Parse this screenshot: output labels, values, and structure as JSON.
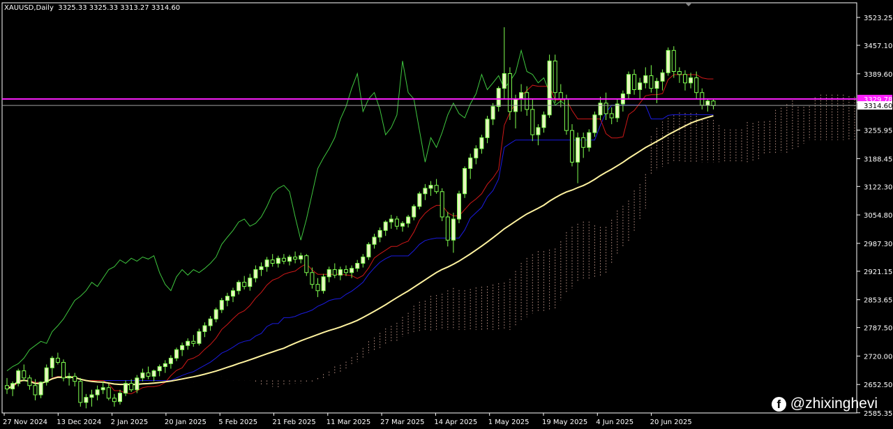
{
  "header": {
    "symbol": "XAUUSD,Daily",
    "ohlc": "3325.33 3325.33 3313.27 3314.60"
  },
  "watermark": {
    "handle": "@zhixinghevi",
    "icon": "facebook-icon"
  },
  "colors": {
    "background": "#000000",
    "candle_up": "#e8f5c0",
    "candle_down": "#000000",
    "candle_wick": "#7fff4f",
    "chikou": "#3fc83f",
    "tenkan": "#d01818",
    "kijun": "#1b1be0",
    "ma": "#fff3a0",
    "horizontal_line": "#ff20ff",
    "price_line": "#a0a0a0",
    "cloud": "#e0b0a0"
  },
  "chart_data": {
    "type": "candlestick",
    "title": "",
    "symbol": "XAUUSD",
    "timeframe": "Daily",
    "ylim": [
      2585,
      3558
    ],
    "y_ticks": [
      3523.25,
      3457.1,
      3389.6,
      3322.1,
      3255.95,
      3188.45,
      3122.3,
      3054.8,
      2987.3,
      2921.15,
      2853.65,
      2787.5,
      2720.0,
      2652.5,
      2585.35
    ],
    "y_tick_labels": [
      "3523.25",
      "3457.10",
      "3389.60",
      "",
      "3255.95",
      "3188.45",
      "3122.30",
      "3054.80",
      "2987.30",
      "2921.15",
      "2853.65",
      "2787.50",
      "2720.00",
      "2652.50",
      "2585.35"
    ],
    "x_tick_labels": [
      "27 Nov 2024",
      "13 Dec 2024",
      "2 Jan 2025",
      "20 Jan 2025",
      "5 Feb 2025",
      "21 Feb 2025",
      "11 Mar 2025",
      "27 Mar 2025",
      "14 Apr 2025",
      "1 May 2025",
      "19 May 2025",
      "4 Jun 2025",
      "20 Jun 2025"
    ],
    "horizontal_line": {
      "value": 3329.78,
      "label": "3329.78"
    },
    "current_price": {
      "value": 3314.6,
      "label": "3314.60"
    },
    "ohlc": [
      [
        2650,
        2668,
        2630,
        2642
      ],
      [
        2642,
        2660,
        2625,
        2655
      ],
      [
        2655,
        2690,
        2648,
        2685
      ],
      [
        2685,
        2700,
        2660,
        2668
      ],
      [
        2668,
        2675,
        2640,
        2650
      ],
      [
        2650,
        2665,
        2615,
        2628
      ],
      [
        2628,
        2660,
        2620,
        2658
      ],
      [
        2658,
        2700,
        2650,
        2692
      ],
      [
        2692,
        2720,
        2670,
        2715
      ],
      [
        2715,
        2728,
        2700,
        2705
      ],
      [
        2705,
        2712,
        2660,
        2668
      ],
      [
        2668,
        2680,
        2650,
        2672
      ],
      [
        2672,
        2680,
        2648,
        2660
      ],
      [
        2660,
        2668,
        2600,
        2610
      ],
      [
        2610,
        2630,
        2596,
        2622
      ],
      [
        2622,
        2640,
        2600,
        2628
      ],
      [
        2628,
        2650,
        2615,
        2640
      ],
      [
        2640,
        2660,
        2630,
        2645
      ],
      [
        2645,
        2655,
        2615,
        2620
      ],
      [
        2620,
        2630,
        2600,
        2612
      ],
      [
        2612,
        2640,
        2605,
        2632
      ],
      [
        2632,
        2662,
        2625,
        2655
      ],
      [
        2655,
        2665,
        2635,
        2640
      ],
      [
        2640,
        2675,
        2632,
        2668
      ],
      [
        2668,
        2690,
        2660,
        2680
      ],
      [
        2680,
        2695,
        2665,
        2672
      ],
      [
        2672,
        2688,
        2660,
        2685
      ],
      [
        2685,
        2700,
        2672,
        2695
      ],
      [
        2695,
        2710,
        2680,
        2702
      ],
      [
        2702,
        2722,
        2690,
        2715
      ],
      [
        2715,
        2740,
        2708,
        2735
      ],
      [
        2735,
        2752,
        2720,
        2745
      ],
      [
        2745,
        2762,
        2735,
        2755
      ],
      [
        2755,
        2770,
        2742,
        2750
      ],
      [
        2750,
        2785,
        2745,
        2778
      ],
      [
        2778,
        2800,
        2765,
        2792
      ],
      [
        2792,
        2815,
        2780,
        2808
      ],
      [
        2808,
        2835,
        2800,
        2830
      ],
      [
        2830,
        2858,
        2822,
        2852
      ],
      [
        2852,
        2870,
        2838,
        2862
      ],
      [
        2862,
        2882,
        2848,
        2875
      ],
      [
        2875,
        2900,
        2866,
        2895
      ],
      [
        2895,
        2910,
        2878,
        2885
      ],
      [
        2885,
        2915,
        2875,
        2905
      ],
      [
        2905,
        2935,
        2895,
        2925
      ],
      [
        2925,
        2942,
        2910,
        2932
      ],
      [
        2932,
        2955,
        2920,
        2948
      ],
      [
        2948,
        2962,
        2932,
        2940
      ],
      [
        2940,
        2958,
        2930,
        2952
      ],
      [
        2952,
        2962,
        2938,
        2945
      ],
      [
        2945,
        2960,
        2935,
        2955
      ],
      [
        2955,
        2968,
        2940,
        2950
      ],
      [
        2950,
        2965,
        2940,
        2958
      ],
      [
        2958,
        2962,
        2910,
        2918
      ],
      [
        2918,
        2930,
        2880,
        2890
      ],
      [
        2890,
        2905,
        2860,
        2875
      ],
      [
        2875,
        2915,
        2868,
        2908
      ],
      [
        2908,
        2932,
        2895,
        2925
      ],
      [
        2925,
        2940,
        2905,
        2912
      ],
      [
        2912,
        2932,
        2900,
        2925
      ],
      [
        2925,
        2935,
        2910,
        2918
      ],
      [
        2918,
        2935,
        2905,
        2928
      ],
      [
        2928,
        2948,
        2920,
        2940
      ],
      [
        2940,
        2962,
        2930,
        2955
      ],
      [
        2955,
        2990,
        2948,
        2985
      ],
      [
        2985,
        3010,
        2975,
        3002
      ],
      [
        3002,
        3025,
        2990,
        3018
      ],
      [
        3018,
        3042,
        3005,
        3038
      ],
      [
        3038,
        3055,
        3022,
        3045
      ],
      [
        3045,
        3052,
        3020,
        3028
      ],
      [
        3028,
        3040,
        3015,
        3035
      ],
      [
        3035,
        3055,
        3025,
        3050
      ],
      [
        3050,
        3080,
        3042,
        3075
      ],
      [
        3075,
        3110,
        3068,
        3105
      ],
      [
        3105,
        3128,
        3090,
        3118
      ],
      [
        3118,
        3135,
        3100,
        3125
      ],
      [
        3125,
        3140,
        3105,
        3110
      ],
      [
        3110,
        3118,
        3040,
        3050
      ],
      [
        3050,
        3062,
        2980,
        2995
      ],
      [
        2995,
        3060,
        2965,
        3045
      ],
      [
        3045,
        3112,
        3035,
        3105
      ],
      [
        3105,
        3170,
        3095,
        3165
      ],
      [
        3165,
        3200,
        3140,
        3190
      ],
      [
        3190,
        3220,
        3175,
        3212
      ],
      [
        3212,
        3245,
        3200,
        3238
      ],
      [
        3238,
        3290,
        3225,
        3282
      ],
      [
        3282,
        3320,
        3268,
        3312
      ],
      [
        3312,
        3360,
        3300,
        3355
      ],
      [
        3355,
        3500,
        3330,
        3390
      ],
      [
        3390,
        3405,
        3280,
        3300
      ],
      [
        3300,
        3340,
        3260,
        3330
      ],
      [
        3330,
        3365,
        3300,
        3345
      ],
      [
        3345,
        3360,
        3290,
        3305
      ],
      [
        3305,
        3330,
        3230,
        3245
      ],
      [
        3245,
        3270,
        3220,
        3262
      ],
      [
        3262,
        3300,
        3250,
        3292
      ],
      [
        3292,
        3435,
        3285,
        3420
      ],
      [
        3420,
        3435,
        3320,
        3345
      ],
      [
        3345,
        3365,
        3310,
        3330
      ],
      [
        3330,
        3340,
        3245,
        3255
      ],
      [
        3255,
        3270,
        3170,
        3180
      ],
      [
        3180,
        3250,
        3130,
        3238
      ],
      [
        3238,
        3250,
        3190,
        3215
      ],
      [
        3215,
        3258,
        3205,
        3250
      ],
      [
        3250,
        3300,
        3240,
        3292
      ],
      [
        3292,
        3335,
        3280,
        3320
      ],
      [
        3320,
        3345,
        3280,
        3295
      ],
      [
        3295,
        3310,
        3270,
        3285
      ],
      [
        3285,
        3330,
        3275,
        3318
      ],
      [
        3318,
        3350,
        3300,
        3342
      ],
      [
        3342,
        3395,
        3330,
        3388
      ],
      [
        3388,
        3400,
        3340,
        3352
      ],
      [
        3352,
        3380,
        3330,
        3368
      ],
      [
        3368,
        3405,
        3355,
        3385
      ],
      [
        3385,
        3410,
        3345,
        3355
      ],
      [
        3355,
        3380,
        3320,
        3372
      ],
      [
        3372,
        3400,
        3350,
        3392
      ],
      [
        3392,
        3452,
        3385,
        3445
      ],
      [
        3445,
        3455,
        3380,
        3395
      ],
      [
        3395,
        3405,
        3368,
        3388
      ],
      [
        3388,
        3398,
        3350,
        3368
      ],
      [
        3368,
        3392,
        3355,
        3380
      ],
      [
        3380,
        3395,
        3330,
        3345
      ],
      [
        3345,
        3355,
        3305,
        3315
      ],
      [
        3315,
        3330,
        3300,
        3325
      ],
      [
        3325,
        3330,
        3305,
        3314
      ]
    ]
  }
}
